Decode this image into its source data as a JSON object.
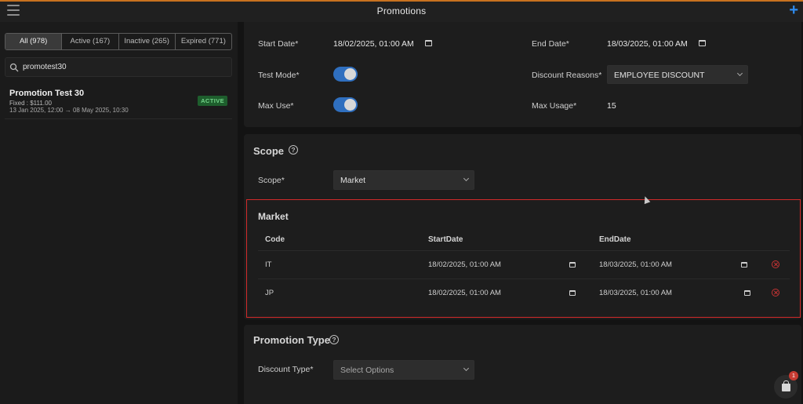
{
  "header": {
    "title": "Promotions"
  },
  "left": {
    "tabs": [
      {
        "label": "All (978)"
      },
      {
        "label": "Active (167)"
      },
      {
        "label": "Inactive (265)"
      },
      {
        "label": "Expired (771)"
      }
    ],
    "search_value": "promotest30",
    "promo": {
      "name": "Promotion Test 30",
      "fixed": "Fixed : $111.00",
      "dates": "13 Jan 2025, 12:00 → 08 May 2025, 10:30",
      "status": "ACTIVE"
    }
  },
  "details": {
    "start_date_label": "Start Date*",
    "start_date_value": "18/02/2025, 01:00 AM",
    "end_date_label": "End Date*",
    "end_date_value": "18/03/2025, 01:00 AM",
    "test_mode_label": "Test Mode*",
    "discount_reasons_label": "Discount Reasons*",
    "discount_reasons_value": "EMPLOYEE DISCOUNT",
    "max_use_label": "Max Use*",
    "max_usage_label": "Max Usage*",
    "max_usage_value": "15"
  },
  "scope": {
    "title": "Scope",
    "label": "Scope*",
    "value": "Market"
  },
  "market": {
    "title": "Market",
    "headers": {
      "code": "Code",
      "start": "StartDate",
      "end": "EndDate"
    },
    "rows": [
      {
        "code": "IT",
        "start": "18/02/2025, 01:00 AM",
        "end": "18/03/2025, 01:00 AM"
      },
      {
        "code": "JP",
        "start": "18/02/2025, 01:00 AM",
        "end": "18/03/2025, 01:00 AM"
      }
    ]
  },
  "promotion_type": {
    "title": "Promotion Type",
    "discount_type_label": "Discount Type*",
    "discount_type_placeholder": "Select Options"
  },
  "cart": {
    "badge": "1"
  },
  "colors": {
    "accent": "#2f8cf0",
    "toggle_on": "#2f6fbf",
    "highlight_border": "#d12a2a",
    "active_badge": "#1e5e2d"
  },
  "icons": {
    "menu": "hamburger-icon",
    "add": "plus-icon",
    "search": "search-icon",
    "calendar": "calendar-icon",
    "help": "question-circle-icon",
    "remove": "remove-circle-icon",
    "cart": "shopping-bag-icon"
  }
}
